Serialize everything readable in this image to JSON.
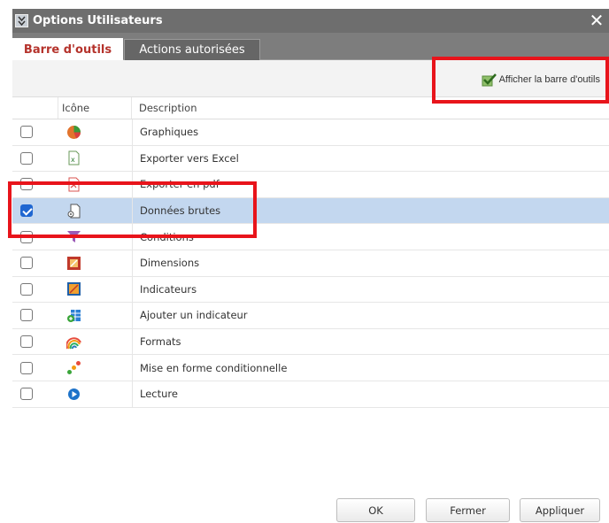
{
  "window": {
    "title": "Options Utilisateurs"
  },
  "tabs": [
    {
      "label": "Barre d'outils",
      "active": true
    },
    {
      "label": "Actions autorisées",
      "active": false
    }
  ],
  "toolbar": {
    "show_toolbar_label": "Afficher la barre d'outils"
  },
  "table": {
    "headers": {
      "icon": "Icône",
      "description": "Description"
    },
    "rows": [
      {
        "icon": "pie-chart-icon",
        "description": "Graphiques",
        "checked": false
      },
      {
        "icon": "excel-icon",
        "description": "Exporter vers Excel",
        "checked": false
      },
      {
        "icon": "pdf-icon",
        "description": "Exporter en pdf",
        "checked": false
      },
      {
        "icon": "raw-data-icon",
        "description": "Données brutes",
        "checked": true
      },
      {
        "icon": "filter-icon",
        "description": "Conditions",
        "checked": false
      },
      {
        "icon": "dimensions-icon",
        "description": "Dimensions",
        "checked": false
      },
      {
        "icon": "indicators-icon",
        "description": "Indicateurs",
        "checked": false
      },
      {
        "icon": "add-indicator-icon",
        "description": "Ajouter un indicateur",
        "checked": false
      },
      {
        "icon": "rainbow-icon",
        "description": "Formats",
        "checked": false
      },
      {
        "icon": "conditional-format-icon",
        "description": "Mise en forme conditionnelle",
        "checked": false
      },
      {
        "icon": "play-icon",
        "description": "Lecture",
        "checked": false
      }
    ]
  },
  "buttons": {
    "ok": "OK",
    "close": "Fermer",
    "apply": "Appliquer"
  },
  "colors": {
    "selected_row": "#c3d7ef",
    "active_tab_text": "#b5332c",
    "annotation": "#e8141b",
    "checkbox_checked": "#1f66d1"
  }
}
